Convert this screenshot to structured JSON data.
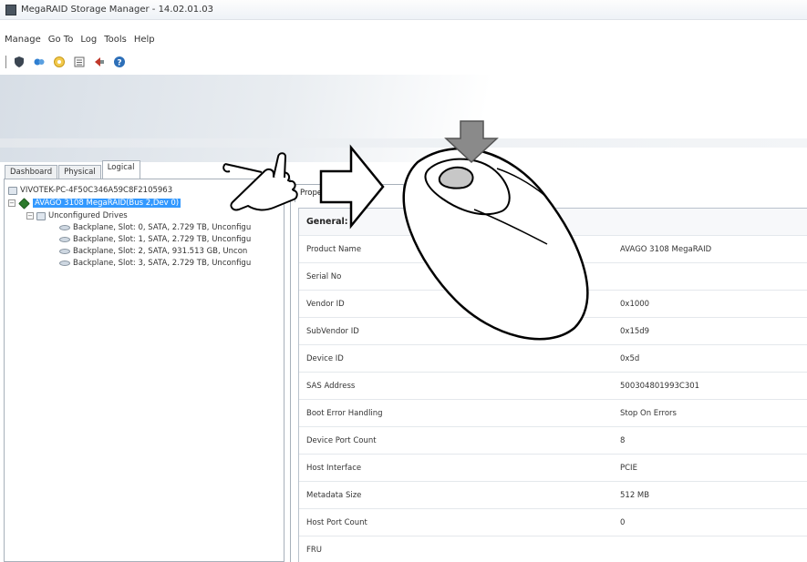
{
  "window": {
    "title": "MegaRAID Storage Manager - 14.02.01.03"
  },
  "menu": {
    "items": [
      "Manage",
      "Go To",
      "Log",
      "Tools",
      "Help"
    ]
  },
  "toolbar": {
    "icons": [
      "shield-icon",
      "refresh-icon",
      "settings-icon",
      "list-icon",
      "flag-icon",
      "help-icon"
    ]
  },
  "tabs": {
    "dashboard": "Dashboard",
    "physical": "Physical",
    "logical": "Logical"
  },
  "tree": {
    "root": "VIVOTEK-PC-4F50C346A59C8F2105963",
    "controller": "AVAGO 3108 MegaRAID(Bus 2,Dev 0)",
    "group": "Unconfigured Drives",
    "drives": [
      "Backplane, Slot: 0, SATA, 2.729 TB, Unconfigu",
      "Backplane, Slot: 1, SATA, 2.729 TB, Unconfigu",
      "Backplane, Slot: 2, SATA, 931.513 GB, Uncon",
      "Backplane, Slot: 3, SATA, 2.729 TB, Unconfigu"
    ]
  },
  "properties": {
    "tab_label": "Prope",
    "section": "General:",
    "rows": [
      {
        "name": "Product Name",
        "value": "AVAGO 3108 MegaRAID"
      },
      {
        "name": "Serial No",
        "value": ""
      },
      {
        "name": "Vendor ID",
        "value": "0x1000"
      },
      {
        "name": "SubVendor ID",
        "value": "0x15d9"
      },
      {
        "name": "Device ID",
        "value": "0x5d"
      },
      {
        "name": "SAS Address",
        "value": "500304801993C301"
      },
      {
        "name": "Boot Error Handling",
        "value": "Stop On Errors"
      },
      {
        "name": "Device Port Count",
        "value": "8"
      },
      {
        "name": "Host Interface",
        "value": "PCIE"
      },
      {
        "name": "Metadata Size",
        "value": "512 MB"
      },
      {
        "name": "Host Port Count",
        "value": "0"
      },
      {
        "name": "FRU",
        "value": ""
      }
    ]
  },
  "colors": {
    "selection": "#3399ff",
    "border": "#a7b0ba",
    "overlay_arrow_gray": "#8a8a8a"
  }
}
